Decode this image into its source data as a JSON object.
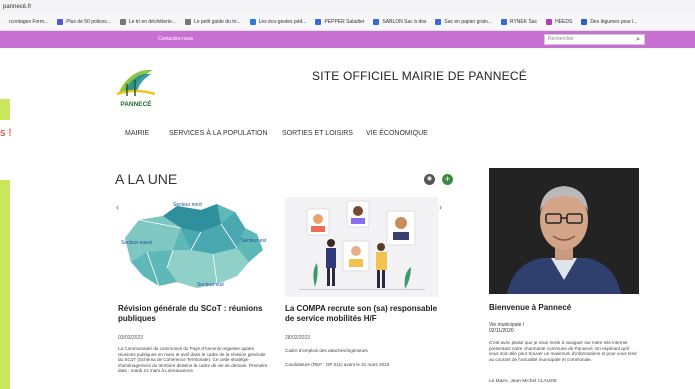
{
  "browser": {
    "url": "pannecé.fr",
    "bookmarks": [
      {
        "label": "rcontages Form...",
        "icon": "none-icon",
        "color": "#f4f4f6"
      },
      {
        "label": "Plus de 50 polices...",
        "icon": "k-icon",
        "color": "#4a5bd6"
      },
      {
        "label": "Le tri en déchèterie...",
        "icon": "page-icon",
        "color": "#777777"
      },
      {
        "label": "Le petit guide du tri...",
        "icon": "page-icon",
        "color": "#777777"
      },
      {
        "label": "Les éco-gestes péd...",
        "icon": "e-icon",
        "color": "#2a7fd0"
      },
      {
        "label": "PEPPER Saladier",
        "icon": "tag-icon",
        "color": "#3a6ad6"
      },
      {
        "label": "SABLON Sac à dos",
        "icon": "tag-icon",
        "color": "#3a6ad6"
      },
      {
        "label": "Sac en papier grain...",
        "icon": "tag-icon",
        "color": "#3a6ad6"
      },
      {
        "label": "RYNEK Sac",
        "icon": "tag-icon",
        "color": "#3a6ad6"
      },
      {
        "label": "HEEDS",
        "icon": "h-icon",
        "color": "#b03fb5"
      },
      {
        "label": "Des légumes pour l...",
        "icon": "leaf-icon",
        "color": "#2d5bcc"
      }
    ]
  },
  "topbar": {
    "contact_label": "Contactez-nous",
    "search_placeholder": "Rechercher",
    "bar_color": "#c86fd4"
  },
  "side": {
    "red_text": "s !"
  },
  "header": {
    "site_title": "SITE OFFICIEL MAIRIE DE PANNECÉ",
    "logo_text": "PANNECÉ"
  },
  "nav": {
    "items": [
      "MAIRIE",
      "SERVICES À LA POPULATION",
      "SORTIES ET LOISIRS",
      "VIE ÉCONOMIQUE"
    ]
  },
  "news": {
    "title": "A LA UNE",
    "prev": "‹",
    "next": "›",
    "articles": [
      {
        "title": "Révision générale du SCoT : réunions publiques",
        "date": "03/03/2023",
        "excerpt": "La Communauté de communes du Pays d'Ancenis organise quatre réunions publiques en mars et avril dans le cadre de la révision générale du SCoT (Schéma de Cohérence Territoriale). Ce cette stratégie d'aménagement du territoire dessine le cadre de vie de demain. Première date : mardi 21 mars à Loireauxence.",
        "map_labels": [
          "Secteur nord",
          "Secteur ouest",
          "Secteur est",
          "Secteur sud"
        ]
      },
      {
        "title": "La COMPA recrute son (sa) responsable de service mobilités H/F",
        "date": "28/02/2023",
        "excerpt_lines": [
          "Cadre d'emplois des attachés/ingénieurs",
          "Candidature (REF : OP 011) avant le 31 mars 2023"
        ]
      }
    ]
  },
  "mayor": {
    "welcome_title": "Bienvenue à Pannecé",
    "category": "Vie municipale /",
    "date": "02/11/2020",
    "text": "C'est avec plaisir que je vous invite à naviguer sur notre site internet présentant notre charmante commune de Pannecé. En espérant qu'il vous soit utile pour trouver un maximum d'informations et pour vous tenir au courant de l'actualité municipale et communale.",
    "signature": "Le Maire, Jean-Michel CLAUDE"
  }
}
